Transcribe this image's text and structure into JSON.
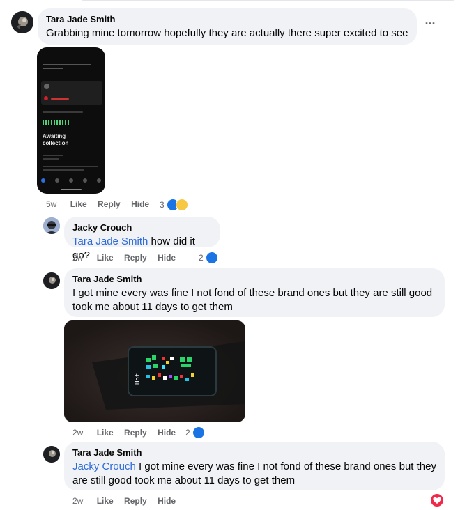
{
  "comments": [
    {
      "author": "Tara Jade Smith",
      "text": "Grabbing mine tomorrow hopefully they are actually there super excited to see",
      "time": "5w",
      "actions": [
        "Like",
        "Reply",
        "Hide"
      ],
      "reaction_count": "3",
      "reactions": [
        "like-icon",
        "haha-icon"
      ],
      "attachment": {
        "type": "phone-screenshot",
        "status_text": "Awaiting collection"
      }
    },
    {
      "author": "Jacky Crouch",
      "mention": "Tara Jade Smith",
      "text": " how did it go?",
      "time": "2w",
      "actions": [
        "Like",
        "Reply",
        "Hide"
      ],
      "reaction_count": "2",
      "reactions": [
        "like-icon"
      ]
    },
    {
      "author": "Tara Jade Smith",
      "text": "I got mine every was fine I not fond of these brand ones but they are still good took me about 11 days to get them",
      "time": "2w",
      "actions": [
        "Like",
        "Reply",
        "Hide"
      ],
      "reaction_count": "2",
      "reactions": [
        "like-icon"
      ],
      "attachment": {
        "type": "photo-led-watch"
      }
    },
    {
      "author": "Tara Jade Smith",
      "mention": "Jacky Crouch",
      "text": " I got mine every was fine I not fond of these brand ones but they are still good took me about 11 days to get them",
      "time": "2w",
      "actions": [
        "Like",
        "Reply",
        "Hide"
      ],
      "reactions": [
        "love-icon"
      ]
    }
  ],
  "colors": {
    "bubble": "#f0f2f5",
    "mention": "#2d6bd9",
    "like": "#1b74e4",
    "love": "#f0284a",
    "meta": "#65676b"
  },
  "icons": [
    "more-options-icon",
    "like-icon",
    "haha-icon",
    "love-icon"
  ]
}
